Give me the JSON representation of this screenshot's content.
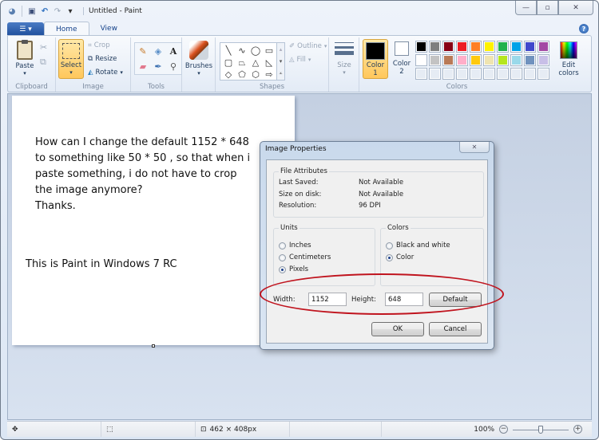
{
  "window": {
    "title": "Untitled - Paint",
    "controls": {
      "minimize": "—",
      "maximize": "▫",
      "close": "✕"
    }
  },
  "quick_access": [
    {
      "icon": "paint-app-icon",
      "glyph": "🎨"
    },
    {
      "icon": "save-icon",
      "glyph": "💾"
    },
    {
      "icon": "undo-icon",
      "glyph": "↶"
    },
    {
      "icon": "redo-icon",
      "glyph": "↷"
    },
    {
      "icon": "customize-dropdown-icon",
      "glyph": "▾"
    }
  ],
  "tabs": {
    "app_menu_glyph": "☰ ▾",
    "items": [
      {
        "label": "Home",
        "active": true
      },
      {
        "label": "View",
        "active": false
      }
    ],
    "help_glyph": "?"
  },
  "ribbon": {
    "clipboard": {
      "label": "Clipboard",
      "paste": "Paste",
      "cut_glyph": "✂",
      "copy_glyph": "⧉"
    },
    "image": {
      "label": "Image",
      "select": "Select",
      "crop": "Crop",
      "resize": "Resize",
      "rotate": "Rotate"
    },
    "tools": {
      "label": "Tools",
      "items": [
        {
          "name": "pencil-icon",
          "glyph": "✏"
        },
        {
          "name": "fill-bucket-icon",
          "glyph": "⛽"
        },
        {
          "name": "text-icon",
          "glyph": "A"
        },
        {
          "name": "eraser-icon",
          "glyph": "▰"
        },
        {
          "name": "color-picker-icon",
          "glyph": "⁄"
        },
        {
          "name": "magnifier-icon",
          "glyph": "🔍"
        }
      ]
    },
    "brushes": {
      "label": "Brushes"
    },
    "shapes": {
      "label": "Shapes",
      "items": [
        {
          "name": "line-shape-icon",
          "glyph": "╲"
        },
        {
          "name": "curve-shape-icon",
          "glyph": "∿"
        },
        {
          "name": "oval-shape-icon",
          "glyph": "◯"
        },
        {
          "name": "rectangle-shape-icon",
          "glyph": "▭"
        },
        {
          "name": "rounded-rectangle-shape-icon",
          "glyph": "▢"
        },
        {
          "name": "polygon-shape-icon",
          "glyph": "⏢"
        },
        {
          "name": "triangle-shape-icon",
          "glyph": "△"
        },
        {
          "name": "right-triangle-shape-icon",
          "glyph": "◺"
        },
        {
          "name": "diamond-shape-icon",
          "glyph": "◇"
        },
        {
          "name": "pentagon-shape-icon",
          "glyph": "⬠"
        },
        {
          "name": "hexagon-shape-icon",
          "glyph": "⬡"
        },
        {
          "name": "arrow-shape-icon",
          "glyph": "⇨"
        }
      ],
      "outline": "Outline",
      "fill": "Fill"
    },
    "size": {
      "label": "Size"
    },
    "colors": {
      "label": "Colors",
      "color1_label_l1": "Color",
      "color1_label_l2": "1",
      "color2_label_l1": "Color",
      "color2_label_l2": "2",
      "color1": "#000000",
      "color2": "#ffffff",
      "edit_label_l1": "Edit",
      "edit_label_l2": "colors",
      "palette": [
        "#000000",
        "#7f7f7f",
        "#880015",
        "#ed1c24",
        "#ff7f27",
        "#fff200",
        "#22b14c",
        "#00a2e8",
        "#3f48cc",
        "#a349a4",
        "#ffffff",
        "#c3c3c3",
        "#b97a57",
        "#ffaec9",
        "#ffc90e",
        "#efe4b0",
        "#b5e61d",
        "#99d9ea",
        "#7092be",
        "#c8bfe7",
        "",
        "",
        "",
        "",
        "",
        "",
        "",
        "",
        "",
        ""
      ]
    }
  },
  "canvas": {
    "text_block": "How can I change the default 1152 * 648\nto something like 50 * 50 , so that when i\npaste something, i do not have to crop\nthe image anymore?\nThanks.",
    "text_note": "This is Paint in Windows 7 RC"
  },
  "dialog": {
    "title": "Image Properties",
    "close_glyph": "✕",
    "file_attributes": {
      "legend": "File Attributes",
      "rows": [
        {
          "label": "Last Saved:",
          "value": "Not Available"
        },
        {
          "label": "Size on disk:",
          "value": "Not Available"
        },
        {
          "label": "Resolution:",
          "value": "96 DPI"
        }
      ]
    },
    "units": {
      "legend": "Units",
      "options": [
        {
          "label": "Inches",
          "checked": false
        },
        {
          "label": "Centimeters",
          "checked": false
        },
        {
          "label": "Pixels",
          "checked": true
        }
      ]
    },
    "colors": {
      "legend": "Colors",
      "options": [
        {
          "label": "Black and white",
          "checked": false
        },
        {
          "label": "Color",
          "checked": true
        }
      ]
    },
    "width_label": "Width:",
    "width_value": "1152",
    "height_label": "Height:",
    "height_value": "648",
    "default_button": "Default",
    "ok_button": "OK",
    "cancel_button": "Cancel",
    "highlight_color": "#c0141e"
  },
  "statusbar": {
    "move_glyph": "✥",
    "selection_glyph": "⬚",
    "size_glyph": "⊡",
    "image_size": "462 × 408px",
    "zoom": "100%",
    "zoom_fraction": 0.5,
    "zoom_out_glyph": "−",
    "zoom_in_glyph": "+"
  }
}
